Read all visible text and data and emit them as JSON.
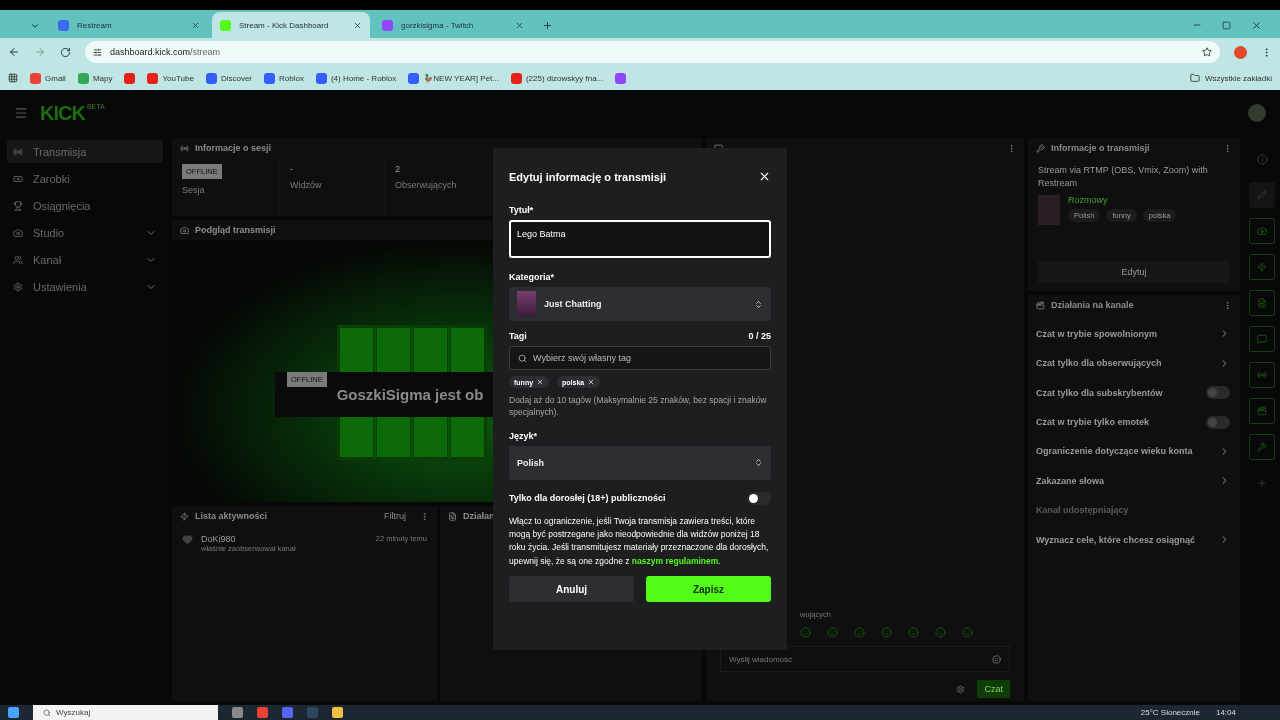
{
  "browser": {
    "tabs": [
      {
        "title": "Restream",
        "kind": "restream",
        "selected": false
      },
      {
        "title": "Stream - Kick Dashboard",
        "kind": "kick",
        "selected": true
      },
      {
        "title": "gorzkisigma - Twitch",
        "kind": "twitch",
        "selected": false
      }
    ],
    "url_host": "dashboard.kick.com",
    "url_path": "/stream",
    "bookmarks": [
      {
        "label": "Gmail",
        "kind": "gmail"
      },
      {
        "label": "Mapy",
        "kind": "maps"
      },
      {
        "kind": "youtube"
      },
      {
        "label": "YouTube",
        "kind": "youtube"
      },
      {
        "label": "Discover",
        "kind": "roblox"
      },
      {
        "label": "Roblox",
        "kind": "roblox"
      },
      {
        "label": "(4) Home - Roblox",
        "kind": "roblox"
      },
      {
        "label": "🦆NEW YEAR] Pet...",
        "kind": "roblox"
      },
      {
        "label": "(225) dizowskyy fna...",
        "kind": "youtube"
      },
      {
        "kind": "twitch"
      }
    ],
    "all_bookmarks": "Wszystkie zakładki"
  },
  "dashboard": {
    "logo": "KICK",
    "logo_tag": "BETA",
    "sidebar": [
      {
        "label": "Transmisja",
        "kind": "link",
        "selected": true
      },
      {
        "label": "Zarobki",
        "kind": "link",
        "selected": false
      },
      {
        "label": "Osiągnięcia",
        "kind": "link",
        "selected": false
      },
      {
        "label": "Studio",
        "kind": "group",
        "selected": false
      },
      {
        "label": "Kanał",
        "kind": "group",
        "selected": false
      },
      {
        "label": "Ustawienia",
        "kind": "group",
        "selected": false
      }
    ],
    "session": {
      "title": "Informacje o sesji",
      "stats": [
        {
          "kind": "badge",
          "value": "OFFLINE",
          "label": "Sesja"
        },
        {
          "kind": "value",
          "value": "-",
          "label": "Widzów"
        },
        {
          "kind": "value",
          "value": "2",
          "label": "Obserwujących"
        }
      ]
    },
    "preview": {
      "title": "Podgląd transmisji",
      "badge": "OFFLINE",
      "headline": "GoszkiSigma jest ob"
    },
    "activity": {
      "title": "Lista aktywności",
      "filter": "Filtruj",
      "items": [
        {
          "name": "DoKi980",
          "action": "właśnie zaobserwował kanał",
          "time": "22 minuty temu"
        }
      ]
    },
    "actions_panel": {
      "title": "Działan"
    },
    "chat": {
      "followers_note": "wujących",
      "placeholder": "Wyślij wiadomość",
      "send": "Czat"
    },
    "stream_info": {
      "title": "Informacje o transmisji",
      "stream_title": "Stream via RTMP (OBS, Vmix, Zoom) with Restream",
      "category": "Rozmowy",
      "tags": [
        "Polish",
        "funny",
        "polska"
      ],
      "edit": "Edytuj"
    },
    "channel_actions": {
      "title": "Działania na kanale",
      "items": [
        {
          "label": "Czat w trybie spowolnionym",
          "kind": "link"
        },
        {
          "label": "Czat tylko dla obserwujących",
          "kind": "link"
        },
        {
          "label": "Czat tylko dla subskrybentów",
          "kind": "toggle",
          "on": false
        },
        {
          "label": "Czat w trybie tylko emotek",
          "kind": "toggle",
          "on": false
        },
        {
          "label": "Ograniczenie dotyczące wieku konta",
          "kind": "link"
        },
        {
          "label": "Zakazane słowa",
          "kind": "link"
        },
        {
          "label": "Kanał udostępniający",
          "kind": "disabled"
        },
        {
          "label": "Wyznacz cele, które chcesz osiągnąć",
          "kind": "link"
        }
      ]
    }
  },
  "modal": {
    "title": "Edytuj informację o transmisji",
    "title_label": "Tytuł*",
    "title_value": "Lego Batma",
    "category_label": "Kategoria*",
    "category": "Just Chatting",
    "tags_label": "Tagi",
    "tags_count": "0 / 25",
    "tag_placeholder": "Wybierz swój własny tag",
    "tags": [
      "funny",
      "polska"
    ],
    "tags_hint": "Dodaj aż do 10 tagów (Maksymalnie 25 znaków, bez spacji i znaków specjalnych).",
    "language_label": "Język*",
    "language": "Polish",
    "adult_label": "Tylko dla dorosłej (18+) publiczności",
    "adult_on": false,
    "adult_text": "Włącz to ograniczenie, jeśli Twoja transmisja zawiera treści, które mogą być postrzegane jako nieodpowiednie dla widzów poniżej 18 roku życia. Jeśli transmitujesz materiały przeznaczone dla dorosłych, upewnij się, że są one zgodne z ",
    "adult_link": "naszym regulaminem",
    "adult_text_end": ".",
    "cancel": "Anuluj",
    "save": "Zapisz"
  },
  "taskbar": {
    "search": "Wyszukaj",
    "weather": "25°C Słonecznie",
    "time": "14:04"
  }
}
